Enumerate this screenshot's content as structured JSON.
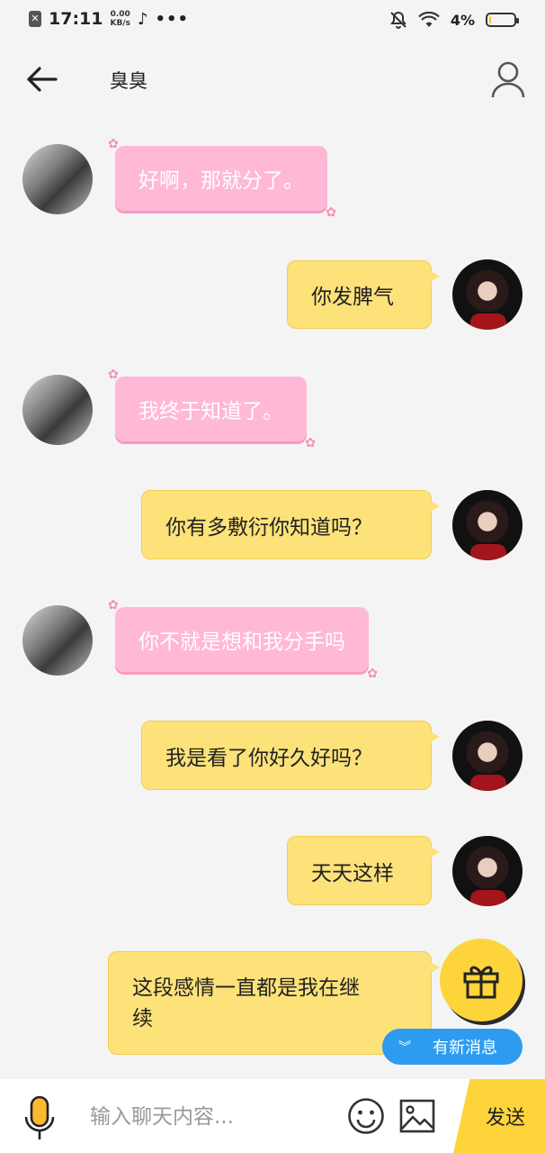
{
  "status_bar": {
    "time": "17:11",
    "net_speed_value": "0.00",
    "net_speed_unit": "KB/s",
    "battery": "4%",
    "battery_level": 0.04
  },
  "header": {
    "title": "臭臭"
  },
  "messages": [
    {
      "side": "left",
      "style": "pink",
      "text": "好啊，那就分了。"
    },
    {
      "side": "right",
      "style": "yellow",
      "text": "你发脾气"
    },
    {
      "side": "left",
      "style": "pink",
      "text": "我终于知道了。"
    },
    {
      "side": "right",
      "style": "yellow",
      "text": "你有多敷衍你知道吗？"
    },
    {
      "side": "left",
      "style": "pink",
      "text": "你不就是想和我分手吗"
    },
    {
      "side": "right",
      "style": "yellow",
      "text": "我是看了你好久好吗？"
    },
    {
      "side": "right",
      "style": "yellow",
      "text": "天天这样"
    },
    {
      "side": "right",
      "style": "yellow",
      "text_line1": "这段感情一直都是我在继",
      "text_line2": "续"
    }
  ],
  "new_message": {
    "label": "有新消息"
  },
  "input_bar": {
    "placeholder": "输入聊天内容...",
    "send_label": "发送"
  },
  "colors": {
    "background": "#f5f4f4",
    "pink_bubble": "#ffb8d6",
    "yellow_bubble": "#fde27a",
    "accent_yellow": "#fdd53b",
    "new_message_blue": "#2d9cf0"
  }
}
